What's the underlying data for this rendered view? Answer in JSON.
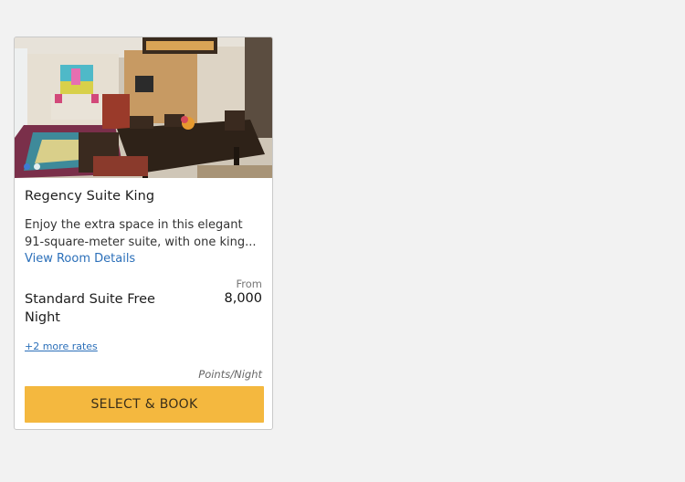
{
  "card": {
    "room_title": "Regency Suite King",
    "description": "Enjoy the extra space in this elegant 91-square-meter suite, with one king...",
    "details_link": "View Room Details",
    "rate": {
      "name": "Standard Suite Free Night",
      "from_label": "From",
      "price": "8,000",
      "more_rates": "+2 more rates",
      "unit": "Points/Night"
    },
    "book_button": "SELECT & BOOK",
    "carousel": {
      "total": 2,
      "active": 1
    }
  },
  "colors": {
    "button": "#f4b83f",
    "link": "#2b6fb9",
    "active_dot": "#3d7bd3"
  }
}
